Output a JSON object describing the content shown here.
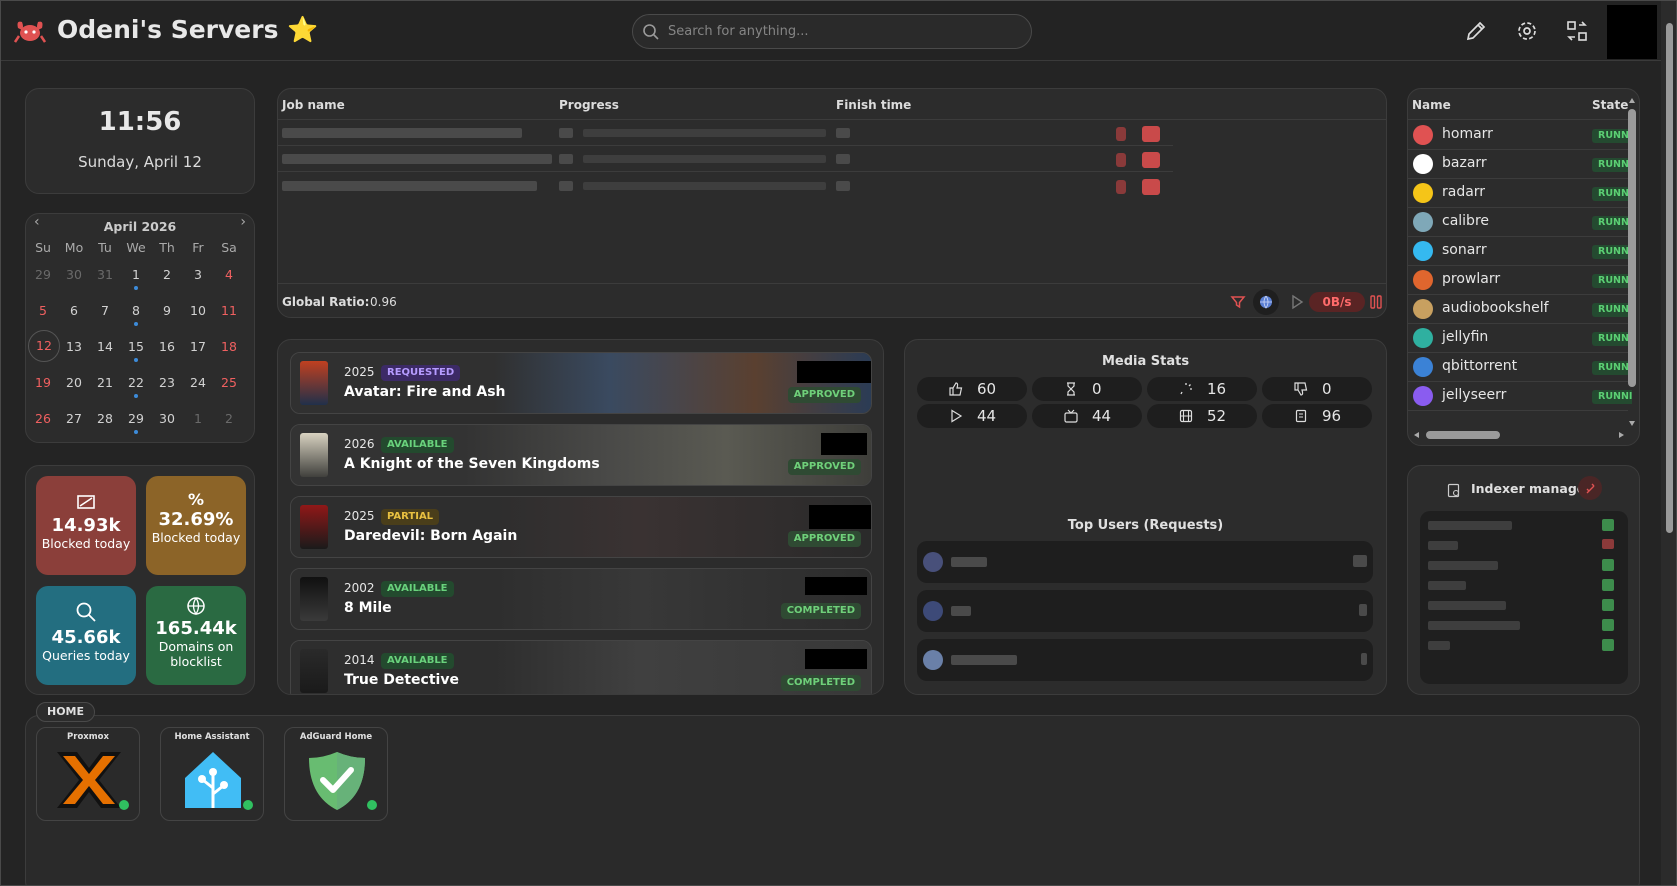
{
  "header": {
    "title": "Odeni's Servers",
    "title_emoji": "⭐",
    "search_placeholder": "Search for anything..."
  },
  "clock": {
    "time": "11:56",
    "date": "Sunday, April 12"
  },
  "calendar": {
    "month_label": "April 2026",
    "prev_glyph": "‹",
    "next_glyph": "›",
    "weekdays": [
      "Su",
      "Mo",
      "Tu",
      "We",
      "Th",
      "Fr",
      "Sa"
    ],
    "weeks": [
      [
        "29",
        "30",
        "31",
        "1",
        "2",
        "3",
        "4"
      ],
      [
        "5",
        "6",
        "7",
        "8",
        "9",
        "10",
        "11"
      ],
      [
        "12",
        "13",
        "14",
        "15",
        "16",
        "17",
        "18"
      ],
      [
        "19",
        "20",
        "21",
        "22",
        "23",
        "24",
        "25"
      ],
      [
        "26",
        "27",
        "28",
        "29",
        "30",
        "1",
        "2"
      ]
    ]
  },
  "adguard": {
    "tiles": [
      {
        "value": "14.93k",
        "label": "Blocked today",
        "color": "#8b3f3a"
      },
      {
        "value": "32.69%",
        "label": "Blocked today",
        "color": "#8c6428"
      },
      {
        "value": "45.66k",
        "label": "Queries today",
        "color": "#236e80"
      },
      {
        "value": "165.44k",
        "label": "Domains on blocklist",
        "color": "#2a6a42"
      }
    ]
  },
  "downloads": {
    "columns": [
      "Job name",
      "Progress",
      "Finish time"
    ],
    "footer_label": "Global Ratio:",
    "footer_value": "0.96",
    "speed": "0B/s"
  },
  "requests": [
    {
      "year": "2025",
      "badge": "REQUESTED",
      "title": "Avatar: Fire and Ash",
      "status": "APPROVED"
    },
    {
      "year": "2026",
      "badge": "AVAILABLE",
      "title": "A Knight of the Seven Kingdoms",
      "status": "APPROVED"
    },
    {
      "year": "2025",
      "badge": "PARTIAL",
      "title": "Daredevil: Born Again",
      "status": "APPROVED"
    },
    {
      "year": "2002",
      "badge": "AVAILABLE",
      "title": "8 Mile",
      "status": "COMPLETED"
    },
    {
      "year": "2014",
      "badge": "AVAILABLE",
      "title": "True Detective",
      "status": "COMPLETED"
    }
  ],
  "media_stats": {
    "title": "Media Stats",
    "stats": [
      {
        "icon": "thumbs-up-icon",
        "value": "60"
      },
      {
        "icon": "hourglass-icon",
        "value": "0"
      },
      {
        "icon": "loader-icon",
        "value": "16"
      },
      {
        "icon": "thumbs-down-icon",
        "value": "0"
      },
      {
        "icon": "play-icon",
        "value": "44"
      },
      {
        "icon": "tv-icon",
        "value": "44"
      },
      {
        "icon": "film-icon",
        "value": "52"
      },
      {
        "icon": "book-icon",
        "value": "96"
      }
    ],
    "top_users_title": "Top Users (Requests)"
  },
  "containers": {
    "columns": [
      "Name",
      "State"
    ],
    "items": [
      {
        "name": "homarr",
        "state": "RUNNING",
        "color": "#e05252"
      },
      {
        "name": "bazarr",
        "state": "RUNNING",
        "color": "#ffffff"
      },
      {
        "name": "radarr",
        "state": "RUNNING",
        "color": "#f5c518"
      },
      {
        "name": "calibre",
        "state": "RUNNING",
        "color": "#7fa8b8"
      },
      {
        "name": "sonarr",
        "state": "RUNNING",
        "color": "#35b9f0"
      },
      {
        "name": "prowlarr",
        "state": "RUNNING",
        "color": "#e0662e"
      },
      {
        "name": "audiobookshelf",
        "state": "RUNNING",
        "color": "#c8a060"
      },
      {
        "name": "jellyfin",
        "state": "RUNNING",
        "color": "#2fb0a0"
      },
      {
        "name": "qbittorrent",
        "state": "RUNNING",
        "color": "#3b82d6"
      },
      {
        "name": "jellyseerr",
        "state": "RUNNING",
        "color": "#8a5cf0"
      }
    ]
  },
  "indexer": {
    "title": "Indexer manager"
  },
  "home": {
    "label": "HOME",
    "apps": [
      {
        "name": "Proxmox"
      },
      {
        "name": "Home Assistant"
      },
      {
        "name": "AdGuard Home"
      }
    ]
  }
}
